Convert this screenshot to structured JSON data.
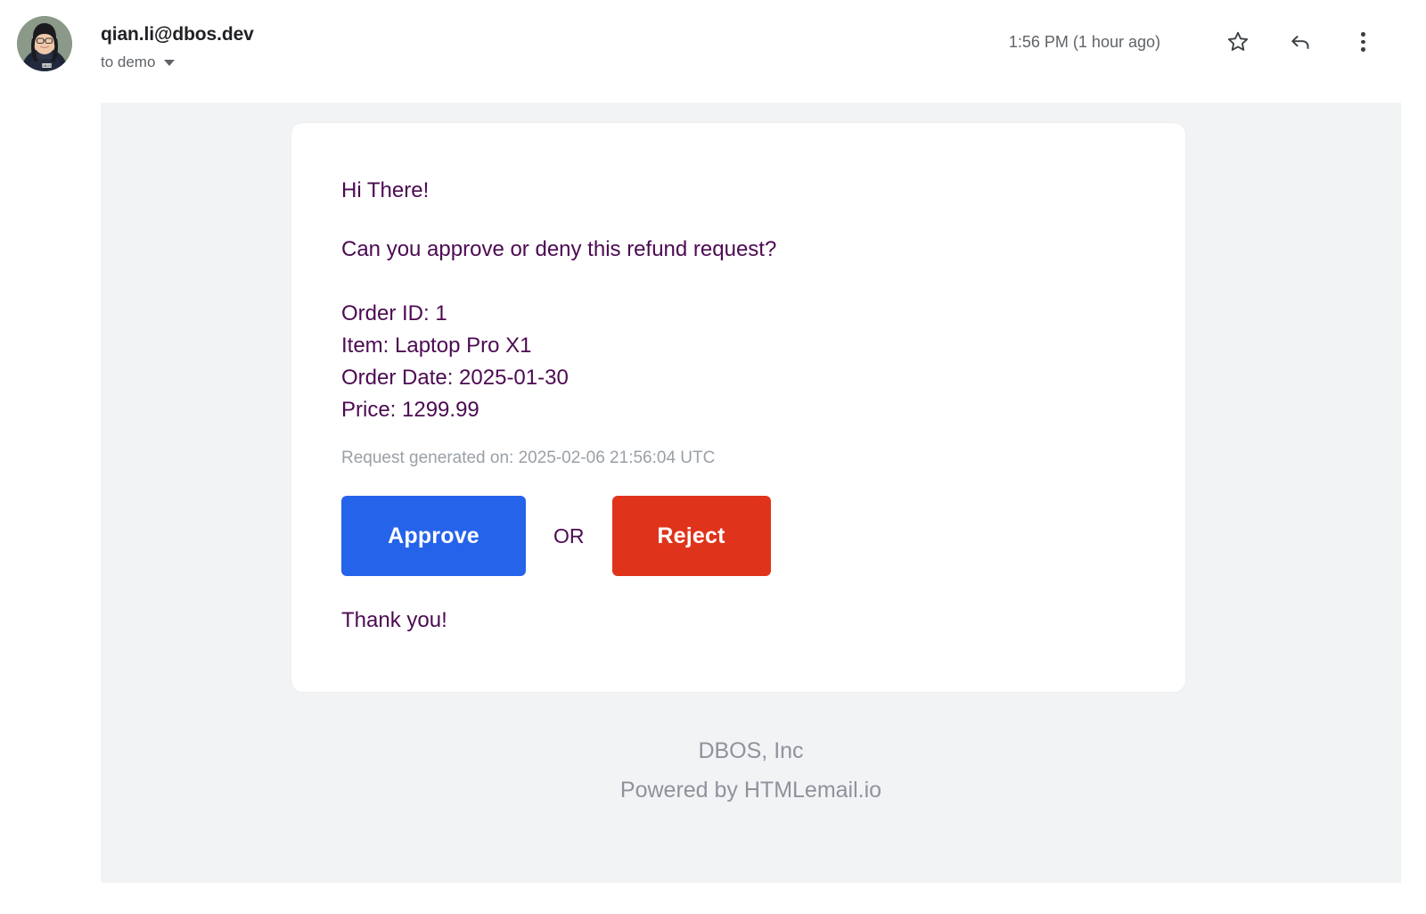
{
  "header": {
    "sender_email": "qian.li@dbos.dev",
    "recipient": "to demo",
    "recipient_caret_icon": "chevron-down-icon",
    "timestamp": "1:56 PM (1 hour ago)",
    "star_icon": "star-outline-icon",
    "reply_icon": "reply-arrow-icon",
    "more_icon": "more-vertical-icon",
    "avatar_alt": "sender-avatar-photo"
  },
  "email": {
    "greeting": "Hi There!",
    "question": "Can you approve or deny this refund request?",
    "details": [
      "Order ID: 1",
      "Item: Laptop Pro X1",
      "Order Date: 2025-01-30",
      "Price: 1299.99"
    ],
    "generated_on": "Request generated on: 2025-02-06 21:56:04 UTC",
    "approve_label": "Approve",
    "or_label": "OR",
    "reject_label": "Reject",
    "thanks": "Thank you!"
  },
  "footer": {
    "company": "DBOS, Inc",
    "powered_by": "Powered by HTMLemail.io"
  },
  "colors": {
    "body_text": "#4c0a52",
    "muted_text": "#9aa0a6",
    "approve_button": "#2563eb",
    "reject_button": "#e0331b",
    "canvas": "#f2f3f5",
    "card": "#ffffff",
    "footer_text": "#8e939b",
    "header_text": "#202124",
    "secondary_text": "#5f6368"
  }
}
